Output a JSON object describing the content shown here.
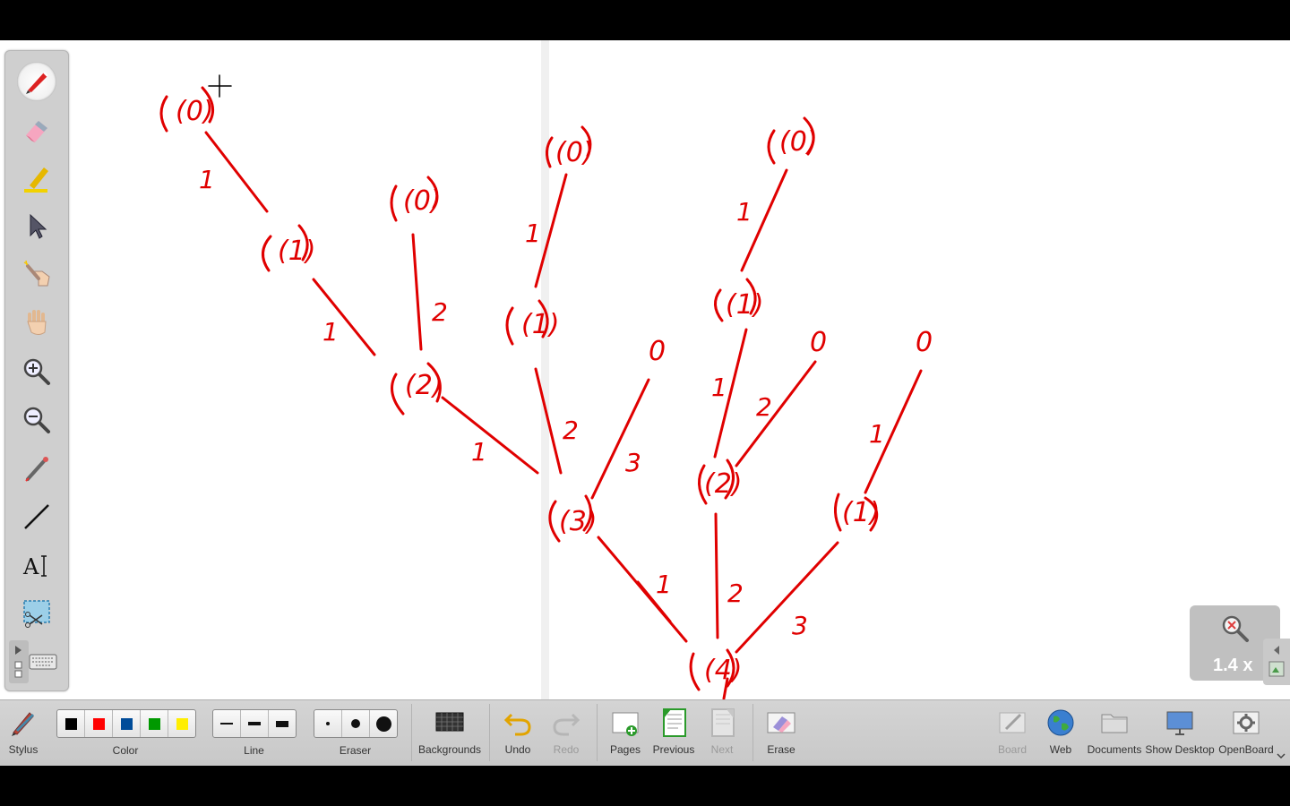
{
  "zoom": {
    "value": "1.4 x",
    "icon": "zoom-reset-icon"
  },
  "palette": {
    "tools": [
      {
        "name": "pen-tool",
        "icon": "red-pen-icon",
        "active": true
      },
      {
        "name": "eraser-tool",
        "icon": "eraser-icon"
      },
      {
        "name": "marker-tool",
        "icon": "highlighter-icon"
      },
      {
        "name": "selector-tool",
        "icon": "arrow-pointer-icon"
      },
      {
        "name": "interact-tool",
        "icon": "pointing-hand-icon"
      },
      {
        "name": "hand-tool",
        "icon": "hand-icon"
      },
      {
        "name": "zoom-in-tool",
        "icon": "zoom-in-icon"
      },
      {
        "name": "zoom-out-tool",
        "icon": "zoom-out-icon"
      },
      {
        "name": "laser-pointer-tool",
        "icon": "laser-pointer-icon"
      },
      {
        "name": "line-tool",
        "icon": "line-icon"
      },
      {
        "name": "text-tool",
        "icon": "text-icon"
      },
      {
        "name": "capture-tool",
        "icon": "scissors-capture-icon"
      },
      {
        "name": "virtual-keyboard-tool",
        "icon": "keyboard-icon"
      }
    ]
  },
  "toolbar": {
    "stylus_label": "Stylus",
    "color_label": "Color",
    "line_label": "Line",
    "eraser_label": "Eraser",
    "backgrounds_label": "Backgrounds",
    "undo_label": "Undo",
    "redo_label": "Redo",
    "pages_label": "Pages",
    "previous_label": "Previous",
    "next_label": "Next",
    "erase_label": "Erase",
    "board_label": "Board",
    "web_label": "Web",
    "documents_label": "Documents",
    "show_desktop_label": "Show Desktop",
    "openboard_label": "OpenBoard",
    "colors": [
      "#000000",
      "#ff0000",
      "#004c99",
      "#009900",
      "#ffee00"
    ],
    "selected_color": "#000000"
  },
  "drawing": {
    "ink_color": "#e00000",
    "node_labels": [
      "(0)",
      "(1)",
      "(0)",
      "(2)",
      "(0)",
      "(1)",
      "(0)",
      "(1)",
      "(3)",
      "0",
      "(2)",
      "0",
      "0",
      "(1)",
      "(4)"
    ],
    "edge_labels": [
      "1",
      "1",
      "2",
      "1",
      "1",
      "2",
      "3",
      "1",
      "1",
      "2",
      "1",
      "1",
      "2",
      "3"
    ]
  }
}
